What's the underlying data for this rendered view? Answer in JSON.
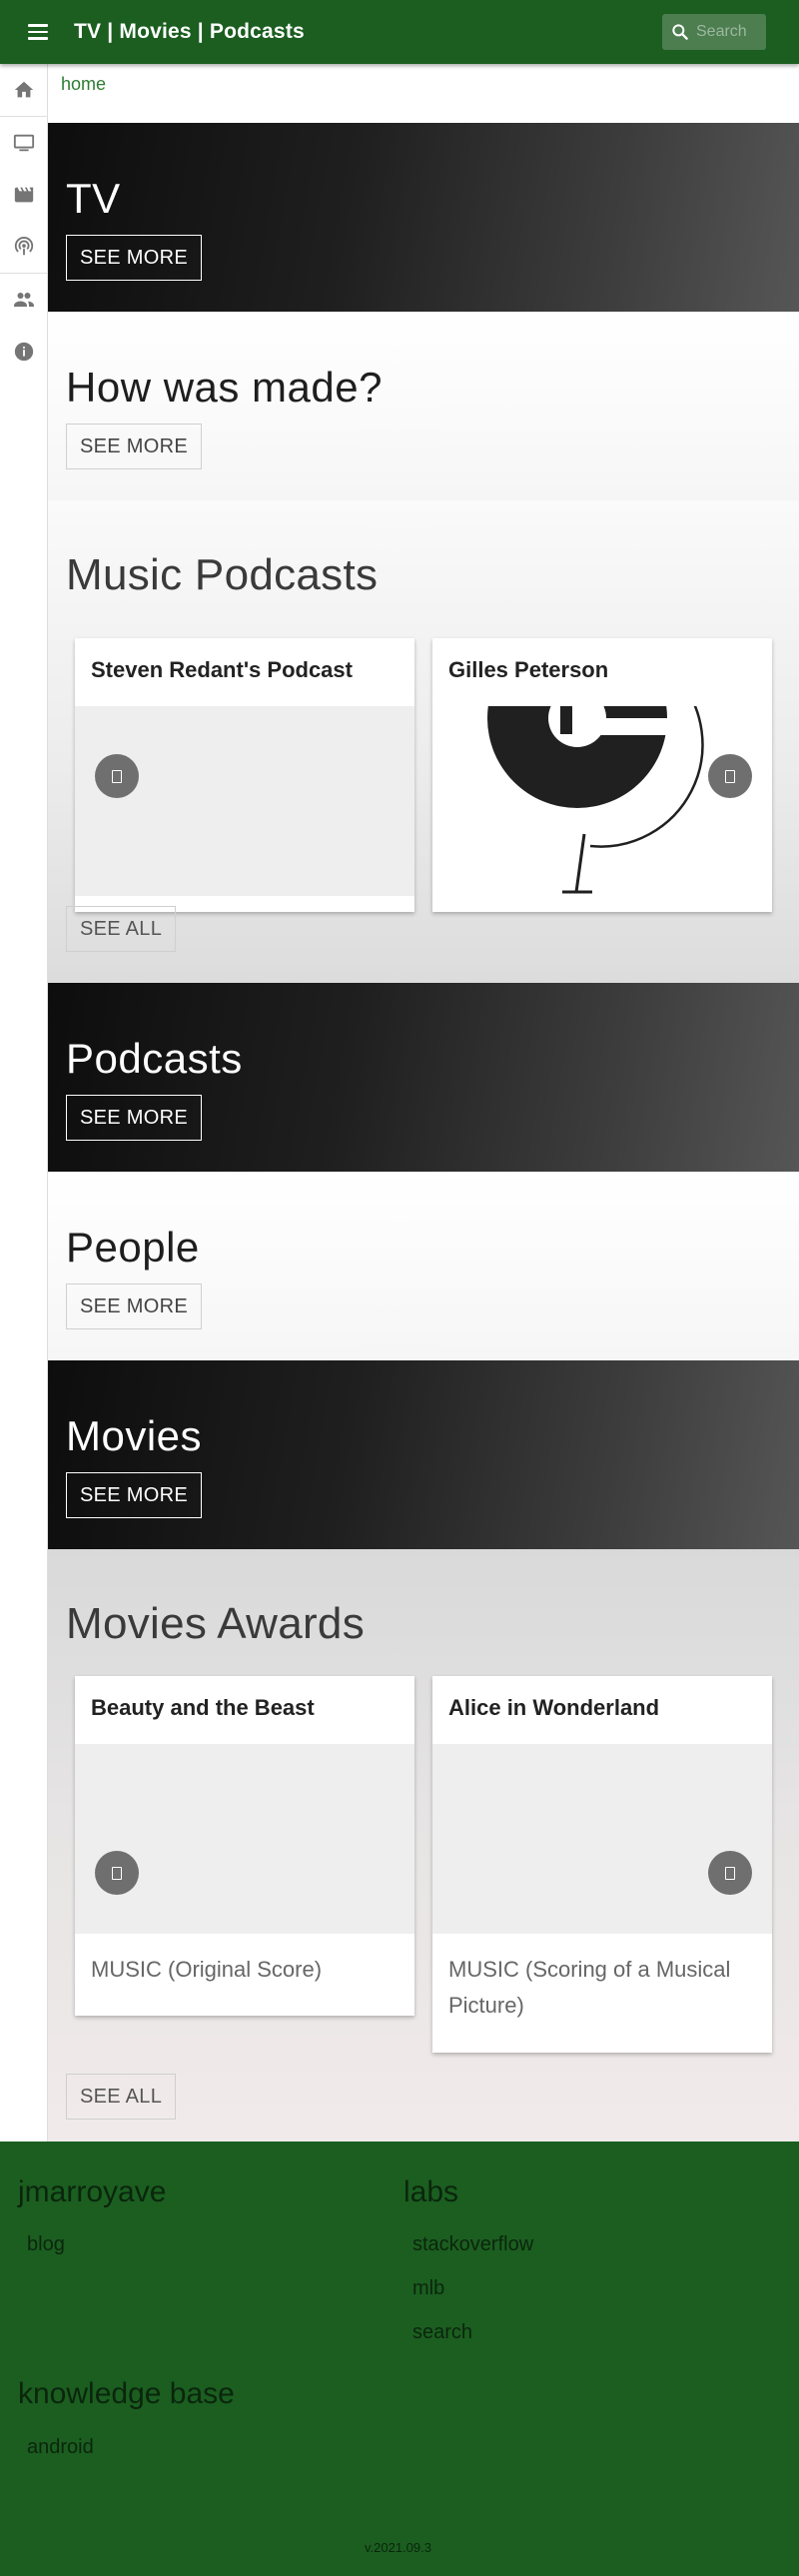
{
  "header": {
    "menu_icon": "menu-icon",
    "title": "TV | Movies | Podcasts",
    "search_icon": "search-icon",
    "search_placeholder": "Search"
  },
  "sidenav": {
    "items": [
      {
        "icon": "home-icon",
        "label": "home"
      },
      {
        "icon": "tv-icon",
        "label": "tv"
      },
      {
        "icon": "movie-icon",
        "label": "movies"
      },
      {
        "icon": "podcast-icon",
        "label": "podcasts"
      },
      {
        "icon": "people-icon",
        "label": "people"
      },
      {
        "icon": "info-icon",
        "label": "info"
      }
    ]
  },
  "breadcrumb": "home",
  "sections": {
    "tv": {
      "title": "TV",
      "button": "SEE MORE"
    },
    "how": {
      "title": "How was made?",
      "button": "SEE MORE"
    },
    "music_podcasts": {
      "title": "Music Podcasts",
      "cards": [
        {
          "title": "Steven Redant's Podcast"
        },
        {
          "title": "Gilles Peterson"
        }
      ],
      "button": "SEE ALL"
    },
    "podcasts": {
      "title": "Podcasts",
      "button": "SEE MORE"
    },
    "people": {
      "title": "People",
      "button": "SEE MORE"
    },
    "movies": {
      "title": "Movies",
      "button": "SEE MORE"
    },
    "movies_awards": {
      "title": "Movies Awards",
      "cards": [
        {
          "title": "Beauty and the Beast",
          "category": "MUSIC (Original Score)"
        },
        {
          "title": "Alice in Wonderland",
          "category": "MUSIC (Scoring of a Musical Picture)"
        }
      ],
      "button": "SEE ALL"
    }
  },
  "footer": {
    "col1": {
      "heading": "jmarroyave",
      "links": [
        "blog"
      ]
    },
    "col2": {
      "heading": "labs",
      "links": [
        "stackoverflow",
        "mlb",
        "search"
      ]
    },
    "col3": {
      "heading": "knowledge base",
      "links": [
        "android"
      ]
    },
    "version": "v.2021.09.3"
  },
  "colors": {
    "primary": "#1b5e20",
    "search_bg": "#4c7e50",
    "breadcrumb": "#2e7d32"
  }
}
